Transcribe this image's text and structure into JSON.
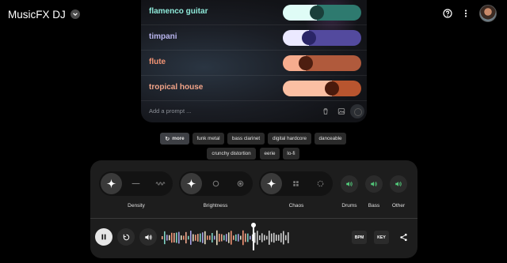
{
  "header": {
    "title": "MusicFX DJ"
  },
  "prompts": [
    {
      "label": "flamenco guitar",
      "color": "#8ee9d9",
      "track_color": "#2e7a6f",
      "fill_color": "#dffcf6",
      "knob_color": "#1a3f3a",
      "weight": 0.42
    },
    {
      "label": "timpani",
      "color": "#b9b5ee",
      "track_color": "#534a9e",
      "fill_color": "#ebe9ff",
      "knob_color": "#2a2566",
      "weight": 0.3
    },
    {
      "label": "flute",
      "color": "#f39474",
      "track_color": "#b05a3c",
      "fill_color": "#f6ac8e",
      "knob_color": "#4d1e10",
      "weight": 0.25
    },
    {
      "label": "tropical house",
      "color": "#f2a489",
      "track_color": "#b8552f",
      "fill_color": "#fbbfa3",
      "knob_color": "#4a1a0c",
      "weight": 0.66
    }
  ],
  "add_prompt": {
    "placeholder": "Add a prompt ..."
  },
  "suggestions": {
    "more_label": "more",
    "row1": [
      "funk metal",
      "bass clarinet",
      "digital hardcore",
      "danceable"
    ],
    "row2": [
      "crunchy distortion",
      "eerie",
      "lo-fi"
    ]
  },
  "controls": {
    "density": {
      "label": "Density",
      "selected": "auto"
    },
    "brightness": {
      "label": "Brightness",
      "selected": "auto"
    },
    "chaos": {
      "label": "Chaos",
      "selected": "auto"
    },
    "instruments": [
      {
        "label": "Drums",
        "icon": "speaker-icon",
        "on": true
      },
      {
        "label": "Bass",
        "icon": "speaker-icon",
        "on": true
      },
      {
        "label": "Other",
        "icon": "speaker-icon",
        "on": true
      }
    ]
  },
  "playback": {
    "state": "playing",
    "bpm_label": "BPM",
    "key_label": "KEY"
  },
  "colors": {
    "accent_green": "#52c97a"
  }
}
